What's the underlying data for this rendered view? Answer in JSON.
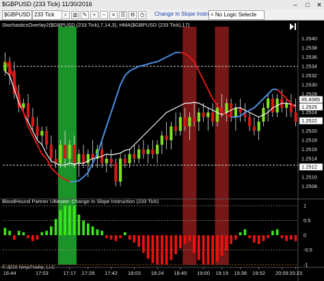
{
  "window": {
    "title": "$GBPUSD (233 Tick)  11/30/2016",
    "min_label": "–",
    "max_label": "□",
    "close_label": "✕"
  },
  "toolbar": {
    "instrument": "$GBPUSD",
    "interval": "233 Tick",
    "active_indicator": "Change In Slope Instruction",
    "logic_select": "< No Logic Selecte",
    "icons": [
      "search-icon",
      "bar-chart-icon",
      "pencil-icon",
      "zoom-in-icon",
      "zoom-out-icon",
      "properties-icon",
      "list-icon",
      "strategy-icon",
      "clock-icon"
    ]
  },
  "chart_data": [
    {
      "type": "candlestick",
      "title": "StochasticsOverlay2($GBPUSD (233 Tick),7,14,3), HMA($GBPUSD (233 Tick),17)",
      "ylim": [
        1.2506,
        1.2542
      ],
      "y_ticks": [
        1.2508,
        1.251,
        1.2512,
        1.2514,
        1.2516,
        1.2518,
        1.252,
        1.2522,
        1.2524,
        1.2526,
        1.2528,
        1.253,
        1.2532,
        1.2534,
        1.2536,
        1.2538,
        1.254
      ],
      "y_tick_labels": [
        "1.2508",
        "1.2510",
        "1.2512",
        "1.2514",
        "1.2516",
        "1.2518",
        "1.2520",
        "1.2522",
        "1.2524",
        "1.2526",
        "1.2528",
        "1.2530",
        "1.2532",
        "1.2534",
        "1.2536",
        "1.2538",
        "1.2540"
      ],
      "h_lines": [
        1.2534,
        1.25126
      ],
      "price_markers": [
        {
          "label": "65.6085",
          "value": 1.25268,
          "color": "#ffffff"
        },
        {
          "label": "1.2525",
          "value": 1.25252,
          "color": "#ffffff"
        },
        {
          "label": "1.2522",
          "value": 1.25222,
          "color": "#ffffff"
        },
        {
          "label": "1.2512",
          "value": 1.25122,
          "color": "#ffffff"
        }
      ],
      "candles": [
        {
          "o": 1.2533,
          "h": 1.2537,
          "l": 1.2532,
          "c": 1.2535
        },
        {
          "o": 1.2535,
          "h": 1.2536,
          "l": 1.253,
          "c": 1.2532
        },
        {
          "o": 1.2533,
          "h": 1.2535,
          "l": 1.2527,
          "c": 1.2528
        },
        {
          "o": 1.2528,
          "h": 1.253,
          "l": 1.2524,
          "c": 1.2525
        },
        {
          "o": 1.2525,
          "h": 1.2527,
          "l": 1.2524,
          "c": 1.2526
        },
        {
          "o": 1.2526,
          "h": 1.2528,
          "l": 1.2522,
          "c": 1.2523
        },
        {
          "o": 1.2523,
          "h": 1.2525,
          "l": 1.252,
          "c": 1.2521
        },
        {
          "o": 1.2521,
          "h": 1.2523,
          "l": 1.2518,
          "c": 1.2519
        },
        {
          "o": 1.2519,
          "h": 1.2521,
          "l": 1.2517,
          "c": 1.252
        },
        {
          "o": 1.252,
          "h": 1.2521,
          "l": 1.2516,
          "c": 1.2517
        },
        {
          "o": 1.2517,
          "h": 1.2519,
          "l": 1.2513,
          "c": 1.2514
        },
        {
          "o": 1.2514,
          "h": 1.2516,
          "l": 1.2512,
          "c": 1.2513
        },
        {
          "o": 1.2513,
          "h": 1.2518,
          "l": 1.2512,
          "c": 1.2517
        },
        {
          "o": 1.2517,
          "h": 1.252,
          "l": 1.2512,
          "c": 1.2514
        },
        {
          "o": 1.2514,
          "h": 1.2518,
          "l": 1.2513,
          "c": 1.2517
        },
        {
          "o": 1.2517,
          "h": 1.2519,
          "l": 1.2512,
          "c": 1.2513
        },
        {
          "o": 1.2513,
          "h": 1.2516,
          "l": 1.251,
          "c": 1.2515
        },
        {
          "o": 1.2515,
          "h": 1.2517,
          "l": 1.2512,
          "c": 1.2513
        },
        {
          "o": 1.2513,
          "h": 1.2516,
          "l": 1.251,
          "c": 1.2515
        },
        {
          "o": 1.2515,
          "h": 1.2518,
          "l": 1.2512,
          "c": 1.2514
        },
        {
          "o": 1.2514,
          "h": 1.2517,
          "l": 1.2512,
          "c": 1.2516
        },
        {
          "o": 1.2516,
          "h": 1.2518,
          "l": 1.2512,
          "c": 1.2513
        },
        {
          "o": 1.2513,
          "h": 1.2515,
          "l": 1.2511,
          "c": 1.2514
        },
        {
          "o": 1.2514,
          "h": 1.2516,
          "l": 1.2512,
          "c": 1.2513
        },
        {
          "o": 1.2513,
          "h": 1.2514,
          "l": 1.2508,
          "c": 1.2509
        },
        {
          "o": 1.2509,
          "h": 1.2515,
          "l": 1.2508,
          "c": 1.2514
        },
        {
          "o": 1.2514,
          "h": 1.2515,
          "l": 1.2512,
          "c": 1.2513
        },
        {
          "o": 1.2513,
          "h": 1.2516,
          "l": 1.2512,
          "c": 1.2515
        },
        {
          "o": 1.2515,
          "h": 1.2517,
          "l": 1.2513,
          "c": 1.2514
        },
        {
          "o": 1.2514,
          "h": 1.2517,
          "l": 1.2513,
          "c": 1.2516
        },
        {
          "o": 1.2516,
          "h": 1.2518,
          "l": 1.2514,
          "c": 1.2515
        },
        {
          "o": 1.2515,
          "h": 1.2517,
          "l": 1.2513,
          "c": 1.2516
        },
        {
          "o": 1.2516,
          "h": 1.2518,
          "l": 1.2514,
          "c": 1.2515
        },
        {
          "o": 1.2515,
          "h": 1.2518,
          "l": 1.2513,
          "c": 1.2517
        },
        {
          "o": 1.2517,
          "h": 1.252,
          "l": 1.2515,
          "c": 1.2519
        },
        {
          "o": 1.2519,
          "h": 1.2522,
          "l": 1.2516,
          "c": 1.2518
        },
        {
          "o": 1.2518,
          "h": 1.2522,
          "l": 1.2516,
          "c": 1.2521
        },
        {
          "o": 1.2521,
          "h": 1.2524,
          "l": 1.2519,
          "c": 1.252
        },
        {
          "o": 1.252,
          "h": 1.2524,
          "l": 1.2519,
          "c": 1.2523
        },
        {
          "o": 1.2523,
          "h": 1.2525,
          "l": 1.252,
          "c": 1.2521
        },
        {
          "o": 1.2521,
          "h": 1.2524,
          "l": 1.2518,
          "c": 1.2523
        },
        {
          "o": 1.2523,
          "h": 1.2526,
          "l": 1.2521,
          "c": 1.2522
        },
        {
          "o": 1.2522,
          "h": 1.2525,
          "l": 1.252,
          "c": 1.2524
        },
        {
          "o": 1.2524,
          "h": 1.2526,
          "l": 1.2522,
          "c": 1.2523
        },
        {
          "o": 1.2523,
          "h": 1.2525,
          "l": 1.252,
          "c": 1.2524
        },
        {
          "o": 1.2524,
          "h": 1.2526,
          "l": 1.2521,
          "c": 1.2522
        },
        {
          "o": 1.2522,
          "h": 1.2526,
          "l": 1.2521,
          "c": 1.2525
        },
        {
          "o": 1.2525,
          "h": 1.2528,
          "l": 1.2523,
          "c": 1.2524
        },
        {
          "o": 1.2524,
          "h": 1.2527,
          "l": 1.2522,
          "c": 1.2526
        },
        {
          "o": 1.2526,
          "h": 1.2527,
          "l": 1.2522,
          "c": 1.2523
        },
        {
          "o": 1.2523,
          "h": 1.2526,
          "l": 1.252,
          "c": 1.2525
        },
        {
          "o": 1.2525,
          "h": 1.2527,
          "l": 1.2522,
          "c": 1.2524
        },
        {
          "o": 1.2524,
          "h": 1.2526,
          "l": 1.2522,
          "c": 1.2523
        },
        {
          "o": 1.2523,
          "h": 1.2524,
          "l": 1.252,
          "c": 1.2521
        },
        {
          "o": 1.2521,
          "h": 1.2523,
          "l": 1.2519,
          "c": 1.252
        },
        {
          "o": 1.252,
          "h": 1.2523,
          "l": 1.2518,
          "c": 1.2522
        },
        {
          "o": 1.2522,
          "h": 1.2526,
          "l": 1.2521,
          "c": 1.2525
        },
        {
          "o": 1.2525,
          "h": 1.2528,
          "l": 1.2522,
          "c": 1.2527
        },
        {
          "o": 1.2527,
          "h": 1.2528,
          "l": 1.2523,
          "c": 1.2524
        },
        {
          "o": 1.2524,
          "h": 1.2528,
          "l": 1.2523,
          "c": 1.2527
        },
        {
          "o": 1.2527,
          "h": 1.2529,
          "l": 1.2524,
          "c": 1.2525
        },
        {
          "o": 1.2525,
          "h": 1.2527,
          "l": 1.2523,
          "c": 1.2526
        },
        {
          "o": 1.2526,
          "h": 1.2528,
          "l": 1.2523,
          "c": 1.2524
        },
        {
          "o": 1.2524,
          "h": 1.2527,
          "l": 1.2521,
          "c": 1.2522
        }
      ],
      "hma": [
        1.2535,
        1.2534,
        1.2531,
        1.2527,
        1.2524,
        1.2521,
        1.2519,
        1.2517,
        1.2515,
        1.2514,
        1.2512,
        1.2511,
        1.251,
        1.25095,
        1.2509,
        1.2509,
        1.25092,
        1.251,
        1.2511,
        1.2513,
        1.2515,
        1.2518,
        1.2521,
        1.2524,
        1.2527,
        1.253,
        1.2532,
        1.2533,
        1.25335,
        1.2534,
        1.25342,
        1.25345,
        1.25348,
        1.2535,
        1.25355,
        1.2536,
        1.25365,
        1.2537,
        1.2537,
        1.25368,
        1.2536,
        1.2535,
        1.2533,
        1.2531,
        1.2529,
        1.2527,
        1.25255,
        1.2524,
        1.25235,
        1.2523,
        1.2523,
        1.25232,
        1.2524,
        1.25245,
        1.2525,
        1.2526,
        1.2527,
        1.2528,
        1.2529,
        1.2529,
        1.2528,
        1.2527,
        1.2526,
        1.2525
      ],
      "stoch_overlay": [
        1.2533,
        1.2532,
        1.2529,
        1.2526,
        1.2524,
        1.2522,
        1.252,
        1.2518,
        1.2517,
        1.2515,
        1.25135,
        1.2513,
        1.25126,
        1.25126,
        1.2513,
        1.25128,
        1.2513,
        1.2513,
        1.25135,
        1.2514,
        1.25142,
        1.25145,
        1.2515,
        1.25148,
        1.2515,
        1.25152,
        1.25158,
        1.2516,
        1.2517,
        1.2518,
        1.2519,
        1.252,
        1.2521,
        1.2522,
        1.2523,
        1.2524,
        1.25245,
        1.2525,
        1.25255,
        1.2526,
        1.2526,
        1.25262,
        1.2526,
        1.25255,
        1.2525,
        1.25245,
        1.2524,
        1.25235,
        1.2524,
        1.25245,
        1.2525,
        1.2525,
        1.25245,
        1.2524,
        1.25235,
        1.2523,
        1.25235,
        1.2524,
        1.2525,
        1.25255,
        1.2526,
        1.2526,
        1.25258,
        1.25255
      ],
      "signal_zones": [
        {
          "start": 12,
          "end": 15,
          "color": "#1fae2f"
        },
        {
          "start": 39,
          "end": 41,
          "color": "#8b1c1c"
        },
        {
          "start": 46,
          "end": 48,
          "color": "#8b1c1c"
        }
      ]
    },
    {
      "type": "bar",
      "title": "BloodHound Partner Ultimate: Change In Slope Instruction (233 Tick)",
      "ylim": [
        -1,
        1
      ],
      "y_tick_labels": [
        "1",
        "0.5",
        "0",
        "-0.5",
        "-1"
      ],
      "y_ticks": [
        1,
        0.5,
        0,
        -0.5,
        -1
      ],
      "values": [
        0.25,
        0.15,
        -0.15,
        0.15,
        0.1,
        -0.1,
        -0.2,
        -0.15,
        0.1,
        0.15,
        0.3,
        0.55,
        0.85,
        1.0,
        1.0,
        1.0,
        0.7,
        0.5,
        0.4,
        0.3,
        0.2,
        0.15,
        -0.1,
        -0.15,
        -0.2,
        -0.1,
        0.1,
        -0.15,
        -0.25,
        -0.4,
        -0.6,
        -0.8,
        -0.95,
        -1.0,
        -1.0,
        -1.0,
        -0.85,
        -0.65,
        -0.45,
        -0.3,
        -0.2,
        -0.6,
        -0.85,
        -1.0,
        -1.0,
        -1.0,
        -0.9,
        -0.7,
        -0.5,
        -0.3,
        -0.15,
        0.1,
        0.2,
        -0.1,
        -0.25,
        -0.3,
        -0.2,
        -0.1,
        0.15,
        0.2,
        -0.1,
        -0.2,
        -0.15,
        -0.2
      ]
    }
  ],
  "x_axis": {
    "tick_labels": [
      "16:44",
      "17:03",
      "17:17",
      "17:28",
      "17:42",
      "18:03",
      "18:24",
      "18:45",
      "19:00",
      "19:19",
      "19:38",
      "19:52",
      "20:09",
      "20:23"
    ],
    "tick_index": [
      1,
      8,
      14,
      18,
      23,
      28,
      33,
      38,
      43,
      47,
      51,
      55,
      60,
      63
    ]
  },
  "copyright": "© 2016 NinjaTrader, LLC",
  "colors": {
    "up": "#7fe01e",
    "down": "#d41919",
    "hma_up": "#4a90e2",
    "hma_down": "#e01818",
    "overlay": "#ffffff",
    "green_zone": "#1fae2f",
    "red_zone": "#8b1c1c",
    "bar_up": "#3ce61a",
    "bar_down": "#ee1111"
  }
}
